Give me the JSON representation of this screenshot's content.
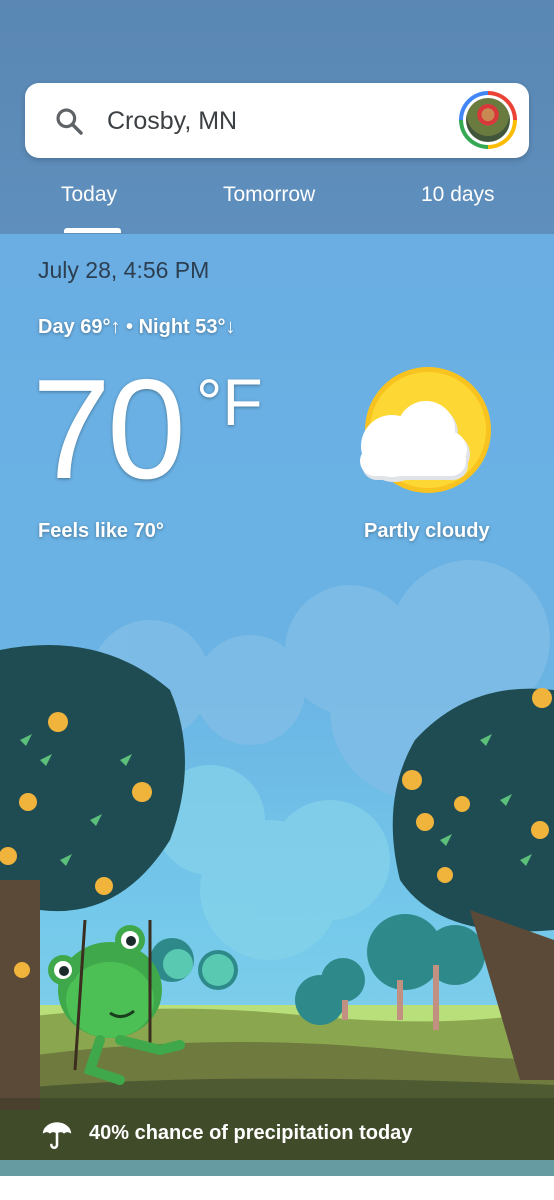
{
  "search": {
    "location": "Crosby, MN"
  },
  "tabs": [
    {
      "label": "Today",
      "selected": true
    },
    {
      "label": "Tomorrow",
      "selected": false
    },
    {
      "label": "10 days",
      "selected": false
    }
  ],
  "weather": {
    "datetime": "July 28, 4:56 PM",
    "day_night": "Day 69°↑ • Night 53°↓",
    "temperature": "70",
    "unit": "°F",
    "feels_like": "Feels like 70°",
    "condition": "Partly cloudy",
    "condition_icon": "partly-cloudy-icon"
  },
  "precipitation": {
    "text": "40% chance of precipitation today",
    "icon": "umbrella-icon"
  }
}
